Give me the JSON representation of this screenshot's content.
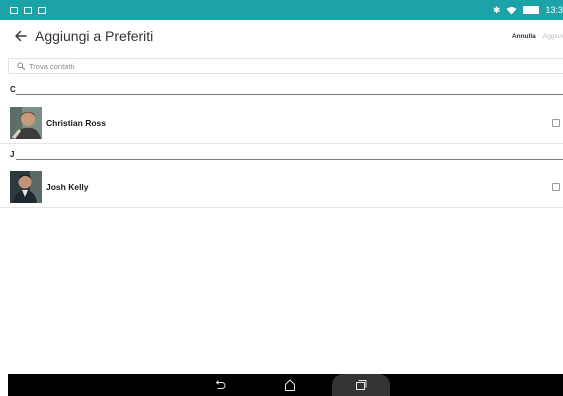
{
  "status_bar": {
    "time": "13:3",
    "background": "#1ba3a7",
    "left_icons": [
      "gallery-icon",
      "download-icon",
      "screenshot-icon"
    ],
    "right_icons": [
      "bluetooth-icon",
      "wifi-icon",
      "battery-icon"
    ]
  },
  "header": {
    "title": "Aggiungi a Preferiti",
    "cancel_label": "Annulla",
    "add_label": "Aggiun"
  },
  "search": {
    "placeholder": "Trova contatti"
  },
  "sections": [
    {
      "letter": "C",
      "contacts": [
        {
          "name": "Christian Ross",
          "checked": false
        }
      ]
    },
    {
      "letter": "J",
      "contacts": [
        {
          "name": "Josh Kelly",
          "checked": false
        }
      ]
    }
  ],
  "nav_bar": {
    "buttons": [
      "back-icon",
      "home-icon",
      "recent-apps-icon"
    ]
  }
}
